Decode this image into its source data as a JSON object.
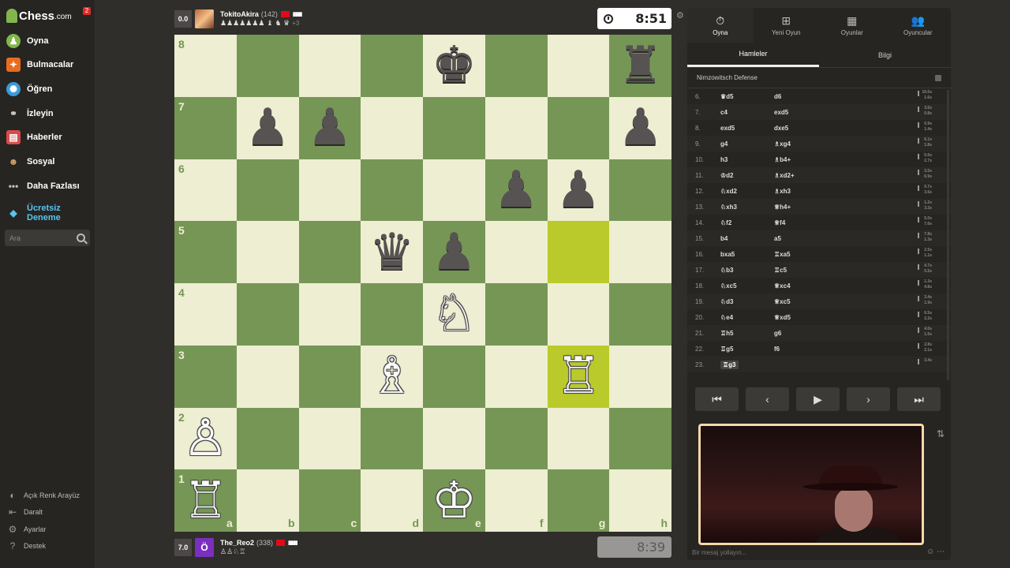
{
  "sidebar": {
    "logo": "Chess",
    "logo_suffix": ".com",
    "notifications": "2",
    "items": [
      {
        "label": "Oyna",
        "icon": "play-pawn-icon"
      },
      {
        "label": "Bulmacalar",
        "icon": "puzzle-icon"
      },
      {
        "label": "Öğren",
        "icon": "learn-icon"
      },
      {
        "label": "İzleyin",
        "icon": "binoculars-icon"
      },
      {
        "label": "Haberler",
        "icon": "news-icon"
      },
      {
        "label": "Sosyal",
        "icon": "social-icon"
      },
      {
        "label": "Daha Fazlası",
        "icon": "more-dots-icon"
      }
    ],
    "premium_line1": "Ücretsiz",
    "premium_line2": "Deneme",
    "search_placeholder": "Ara",
    "bottom": [
      {
        "label": "Açık Renk Arayüz",
        "icon": "theme-toggle-icon"
      },
      {
        "label": "Daralt",
        "icon": "collapse-icon"
      },
      {
        "label": "Ayarlar",
        "icon": "gear-icon"
      },
      {
        "label": "Destek",
        "icon": "help-icon"
      }
    ]
  },
  "top_player": {
    "eval": "0.0",
    "name": "TokitoAkira",
    "rating": "(142)",
    "captured": "♟♟♟♟♟♟♟ ♝ ♞ ♛",
    "extra": "+3",
    "clock": "8:51"
  },
  "bottom_player": {
    "eval": "7.0",
    "avatar_letter": "Ö",
    "name": "The_Reo2",
    "rating": "(338)",
    "captured": "♙♙♘♖",
    "clock": "8:39"
  },
  "board": {
    "ranks": [
      "8",
      "7",
      "6",
      "5",
      "4",
      "3",
      "2",
      "1"
    ],
    "files": [
      "a",
      "b",
      "c",
      "d",
      "e",
      "f",
      "g",
      "h"
    ],
    "highlight": [
      "g5",
      "g3"
    ],
    "pieces": {
      "e8": "♚",
      "h8": "♜",
      "b7": "♟",
      "c7": "♟",
      "h7": "♟",
      "f6": "♟",
      "g6": "♟",
      "d5": "♛",
      "e5": "♟",
      "e4": "♘",
      "d3": "♗",
      "g3": "♖",
      "a2": "♙",
      "a1": "♖",
      "e1": "♔"
    },
    "white_squares": [
      "e4",
      "d3",
      "g3",
      "a2",
      "a1",
      "e1"
    ]
  },
  "panel": {
    "tabs": [
      {
        "label": "Oyna",
        "icon": "stopwatch-icon"
      },
      {
        "label": "Yeni Oyun",
        "icon": "plus-icon"
      },
      {
        "label": "Oyunlar",
        "icon": "board-icon"
      },
      {
        "label": "Oyuncular",
        "icon": "players-icon"
      }
    ],
    "subtabs": [
      "Hamleler",
      "Bilgi"
    ],
    "opening": "Nimzowitsch Defense",
    "moves": [
      {
        "n": "6.",
        "w": "♛d5",
        "b": "d6",
        "t": "10.0s\n1.6s"
      },
      {
        "n": "7.",
        "w": "c4",
        "b": "exd5",
        "t": "3.6s\n0.8s"
      },
      {
        "n": "8.",
        "w": "exd5",
        "b": "dxe5",
        "t": "0.9s\n1.4s"
      },
      {
        "n": "9.",
        "w": "g4",
        "b": "♗xg4",
        "t": "6.1s\n1.8s"
      },
      {
        "n": "10.",
        "w": "h3",
        "b": "♗b4+",
        "t": "5.6s\n2.7s"
      },
      {
        "n": "11.",
        "w": "♔d2",
        "b": "♗xd2+",
        "t": "3.5s\n6.9s"
      },
      {
        "n": "12.",
        "w": "♘xd2",
        "b": "♗xh3",
        "t": "0.7s\n3.6s"
      },
      {
        "n": "13.",
        "w": "♘xh3",
        "b": "♕h4+",
        "t": "1.2s\n3.3s"
      },
      {
        "n": "14.",
        "w": "♘f2",
        "b": "♕f4",
        "t": "5.0s\n7.6s"
      },
      {
        "n": "15.",
        "w": "b4",
        "b": "a5",
        "t": "7.8s\n1.3s"
      },
      {
        "n": "16.",
        "w": "bxa5",
        "b": "♖xa5",
        "t": "2.5s\n1.1s"
      },
      {
        "n": "17.",
        "w": "♘b3",
        "b": "♖c5",
        "t": "4.7s\n5.5s"
      },
      {
        "n": "18.",
        "w": "♘xc5",
        "b": "♕xc4",
        "t": "1.3s\n4.8s"
      },
      {
        "n": "19.",
        "w": "♘d3",
        "b": "♕xc5",
        "t": "3.4s\n1.9s"
      },
      {
        "n": "20.",
        "w": "♘e4",
        "b": "♕xd5",
        "t": "6.5s\n2.2s"
      },
      {
        "n": "21.",
        "w": "♖h5",
        "b": "g6",
        "t": "4.0s\n1.5s"
      },
      {
        "n": "22.",
        "w": "♖g5",
        "b": "f6",
        "t": "2.8s\n2.1s"
      },
      {
        "n": "23.",
        "w": "♖g3",
        "b": "",
        "t": "3.4s"
      }
    ],
    "controls": [
      "⏮",
      "‹",
      "▶",
      "›",
      "⏭"
    ],
    "chat_placeholder": "Bir mesaj yollayın..."
  },
  "colors": {
    "light": "#eeeed2",
    "dark": "#769656",
    "highlight_dark": "#baca2b",
    "premium": "#58c4f0"
  }
}
